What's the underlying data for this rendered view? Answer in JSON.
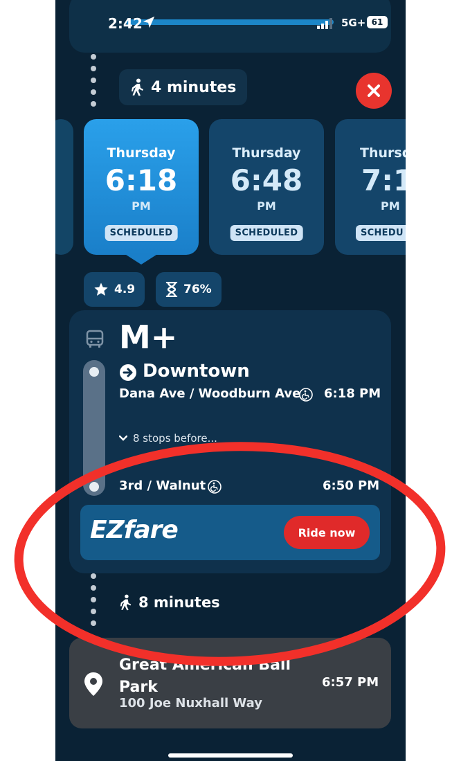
{
  "status": {
    "time": "2:42",
    "network": "5G+",
    "battery": "61"
  },
  "walk_to_stop": {
    "label": "4 minutes"
  },
  "departures": [
    {
      "day": "Thursday",
      "time": "6:18",
      "ampm": "PM",
      "status": "SCHEDULED",
      "selected": true
    },
    {
      "day": "Thursday",
      "time": "6:48",
      "ampm": "PM",
      "status": "SCHEDULED",
      "selected": false
    },
    {
      "day": "Thursdo",
      "time": "7:1",
      "ampm": "PM",
      "status": "SCHEDU",
      "selected": false
    }
  ],
  "stats": {
    "rating": "4.9",
    "reliability": "76%"
  },
  "route": {
    "name": "M+",
    "direction": "Downtown",
    "origin_stop": "Dana Ave / Woodburn Ave",
    "origin_time": "6:18 PM",
    "stops_before": "8 stops before...",
    "dest_stop": "3rd / Walnut",
    "dest_time": "6:50 PM"
  },
  "ezfare": {
    "logo": "EZfare",
    "button": "Ride now"
  },
  "walk_to_dest": {
    "label": "8 minutes"
  },
  "destination": {
    "name": "Great American Ball Park",
    "address": "100 Joe Nuxhall Way",
    "time": "6:57 PM"
  },
  "colors": {
    "accent": "#1a7fc9",
    "danger": "#e8342e",
    "background": "#0a2235"
  }
}
